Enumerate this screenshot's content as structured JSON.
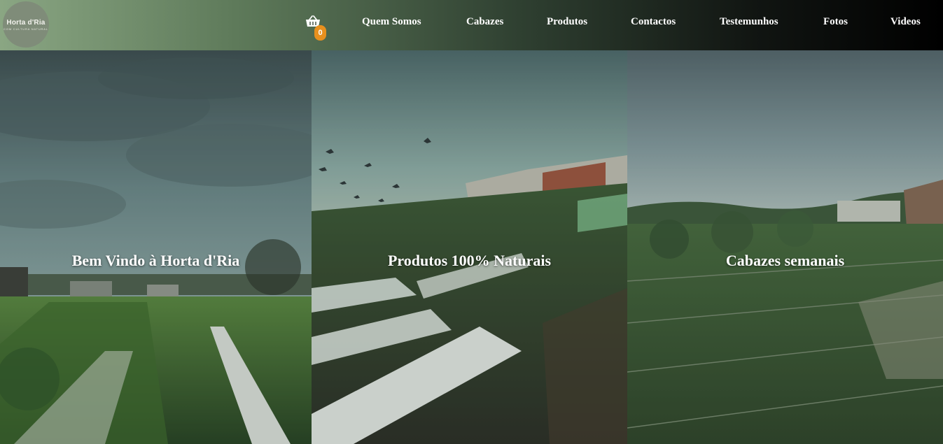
{
  "brand": {
    "logo_main": "Horta d'Ria",
    "logo_sub": "COM CULTURA NATURAL"
  },
  "cart": {
    "count": "0",
    "icon": "basket-icon"
  },
  "nav": {
    "items": [
      {
        "label": "Quem Somos"
      },
      {
        "label": "Cabazes"
      },
      {
        "label": "Produtos"
      },
      {
        "label": "Contactos"
      },
      {
        "label": "Testemunhos"
      },
      {
        "label": "Fotos"
      },
      {
        "label": "Videos"
      }
    ]
  },
  "panels": [
    {
      "title": "Bem Vindo à Horta d'Ria"
    },
    {
      "title": "Produtos 100% Naturais"
    },
    {
      "title": "Cabazes semanais"
    }
  ],
  "colors": {
    "header_gradient_start": "#8aa683",
    "header_gradient_end": "#000000",
    "badge": "#e8901e"
  }
}
